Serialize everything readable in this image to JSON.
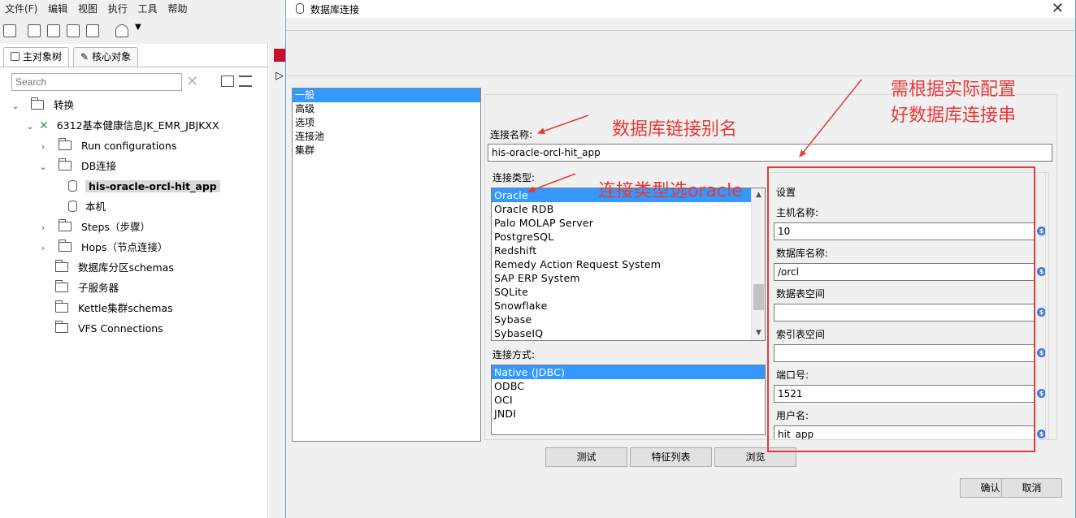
{
  "app": {
    "menu": [
      "文件(F)",
      "编辑",
      "视图",
      "执行",
      "工具",
      "帮助"
    ],
    "tabs": [
      "主对象树",
      "核心对象"
    ],
    "search_placeholder": "Search",
    "tree": {
      "root": "转换",
      "transformation": "6312基本健康信息JK_EMR_JBJKXX",
      "run_configs": "Run configurations",
      "db_conn": "DB连接",
      "conn_selected": "his-oracle-orcl-hit_app",
      "conn_local": "本机",
      "steps": "Steps（步骤）",
      "hops": "Hops（节点连接）",
      "partition_schemas": "数据库分区schemas",
      "slave_servers": "子服务器",
      "cluster_schemas": "Kettle集群schemas",
      "vfs": "VFS Connections"
    }
  },
  "dialog": {
    "title": "数据库连接",
    "nav": [
      "一般",
      "高级",
      "选项",
      "连接池",
      "集群"
    ],
    "conn_name_label": "连接名称:",
    "conn_name_value": "his-oracle-orcl-hit_app",
    "conn_type_label": "连接类型:",
    "conn_types": [
      "Oracle",
      "Oracle RDB",
      "Palo MOLAP Server",
      "PostgreSQL",
      "Redshift",
      "Remedy Action Request System",
      "SAP ERP System",
      "SQLite",
      "Snowflake",
      "Sybase",
      "SybaseIQ"
    ],
    "access_label": "连接方式:",
    "access_types": [
      "Native (JDBC)",
      "ODBC",
      "OCI",
      "JNDI"
    ],
    "settings": {
      "title": "设置",
      "host_label": "主机名称:",
      "host_value": "10",
      "dbname_label": "数据库名称:",
      "dbname_value": "/orcl",
      "tablespace_label": "数据表空间",
      "tablespace_value": "",
      "index_ts_label": "索引表空间",
      "index_ts_value": "",
      "port_label": "端口号:",
      "port_value": "1521",
      "user_label": "用户名:",
      "user_value": "hit_app"
    },
    "buttons": {
      "test": "测试",
      "features": "特征列表",
      "browse": "浏览",
      "ok": "确认",
      "cancel": "取消"
    }
  },
  "annotations": {
    "alias": "数据库链接别名",
    "type": "连接类型选oracle",
    "config_line1": "需根据实际配置",
    "config_line2": "好数据库连接串"
  },
  "colors": {
    "selection": "#3399ff",
    "annotation": "#e53a3a",
    "dialog_bg": "#f0f0f0"
  }
}
